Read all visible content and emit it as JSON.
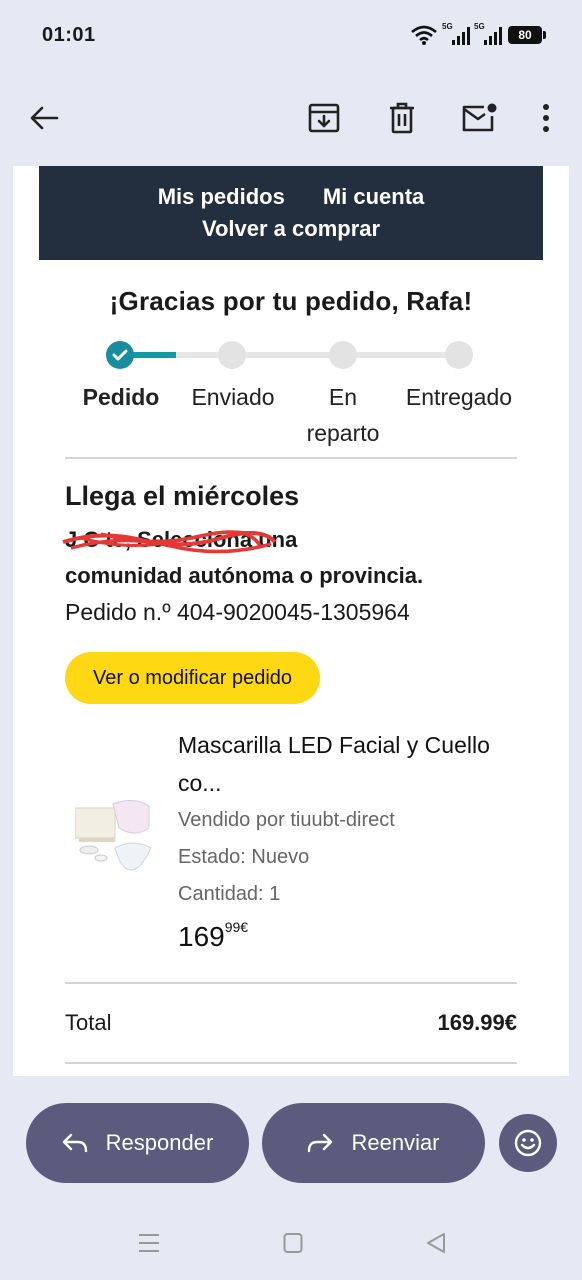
{
  "status": {
    "time": "01:01",
    "net1": "5G",
    "net2": "5G",
    "battery": "80"
  },
  "appbar": {
    "icons": [
      "back-arrow-icon",
      "archive-icon",
      "trash-icon",
      "mark-unread-icon",
      "more-vert-icon"
    ]
  },
  "email": {
    "nav": {
      "orders": "Mis pedidos",
      "account": "Mi cuenta",
      "buy_again": "Volver a comprar"
    },
    "thanks": "¡Gracias por tu pedido, Rafa!",
    "steps": [
      {
        "label": "Pedido",
        "done": true
      },
      {
        "label": "Enviado",
        "done": false
      },
      {
        "label": "En reparto",
        "done": false
      },
      {
        "label": "Entregado",
        "done": false
      }
    ],
    "arrival": "Llega el miércoles",
    "address_line1": "J          C          te, Selecciona una",
    "address_line2": "comunidad autónoma o provincia.",
    "order_number": "Pedido n.º 404-9020045-1305964",
    "view_button": "Ver o modificar pedido",
    "product": {
      "title": "Mascarilla LED Facial y Cuello co...",
      "seller": "Vendido por tiuubt-direct",
      "condition": "Estado: Nuevo",
      "quantity": "Cantidad: 1",
      "price_int": "169",
      "price_dec": "99€"
    },
    "total_label": "Total",
    "total_value": "169.99€"
  },
  "actions": {
    "reply": "Responder",
    "forward": "Reenviar",
    "emoji_icon": "smiley-icon"
  },
  "colors": {
    "nav_bg": "#232f3e",
    "accent_button": "#ffd814",
    "progress": "#1399a4",
    "pill": "#5c5b7d",
    "background": "#e6e8f3"
  }
}
